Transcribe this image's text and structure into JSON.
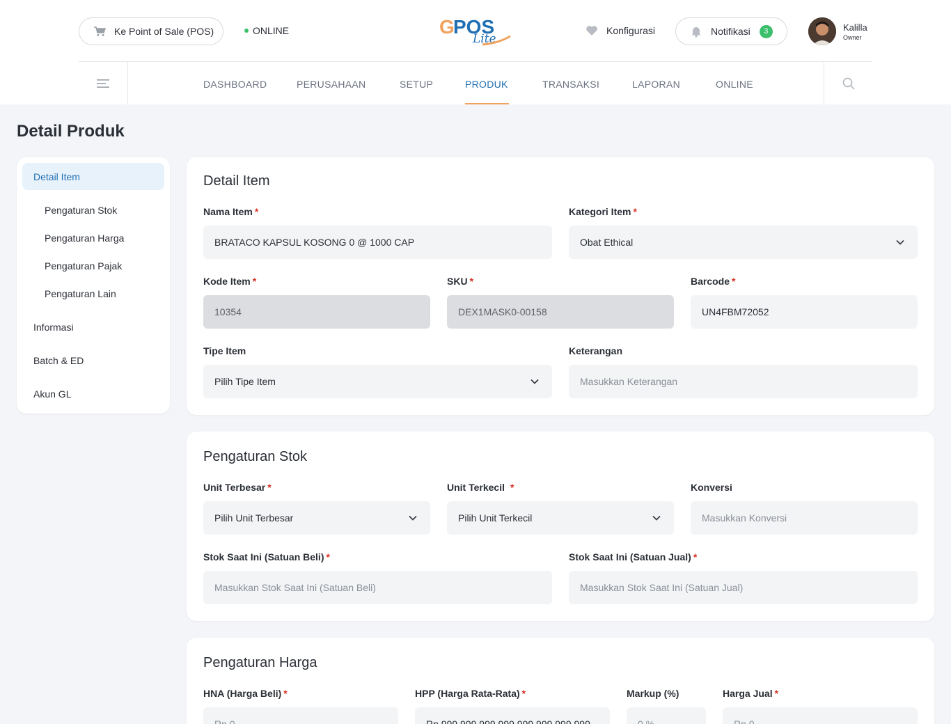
{
  "header": {
    "pos_button": "Ke Point of Sale (POS)",
    "status": "ONLINE",
    "konfigurasi": "Konfigurasi",
    "notifikasi": "Notifikasi",
    "notif_count": "3",
    "user_name": "Kalilla",
    "user_role": "Owner",
    "logo_text": "GPOS",
    "logo_sub": "Lite"
  },
  "nav": {
    "items": [
      "DASHBOARD",
      "PERUSAHAAN",
      "SETUP",
      "PRODUK",
      "TRANSAKSI",
      "LAPORAN",
      "ONLINE"
    ],
    "active": "PRODUK"
  },
  "page": {
    "title": "Detail Produk"
  },
  "sidemenu": {
    "items": [
      "Detail Item",
      "Pengaturan Stok",
      "Pengaturan Harga",
      "Pengaturan Pajak",
      "Pengaturan Lain",
      "Informasi",
      "Batch & ED",
      "Akun GL"
    ]
  },
  "detail_item": {
    "title": "Detail Item",
    "nama_label": "Nama Item",
    "nama_value": "BRATACO KAPSUL KOSONG 0 @ 1000 CAP",
    "kategori_label": "Kategori Item",
    "kategori_value": "Obat Ethical",
    "kode_label": "Kode Item",
    "kode_value": "10354",
    "sku_label": "SKU",
    "sku_value": "DEX1MASK0-00158",
    "barcode_label": "Barcode",
    "barcode_value": "UN4FBM72052",
    "tipe_label": "Tipe Item",
    "tipe_placeholder": "Pilih Tipe Item",
    "ket_label": "Keterangan",
    "ket_placeholder": "Masukkan Keterangan"
  },
  "stok": {
    "title": "Pengaturan Stok",
    "unit_besar_label": "Unit Terbesar",
    "unit_besar_placeholder": "Pilih Unit Terbesar",
    "unit_kecil_label": "Unit Terkecil",
    "unit_kecil_placeholder": "Pilih Unit Terkecil",
    "konversi_label": "Konversi",
    "konversi_placeholder": "Masukkan Konversi",
    "stok_beli_label": "Stok Saat Ini (Satuan Beli)",
    "stok_beli_placeholder": "Masukkan Stok Saat Ini (Satuan Beli)",
    "stok_jual_label": "Stok Saat Ini (Satuan Jual)",
    "stok_jual_placeholder": "Masukkan Stok Saat Ini (Satuan Jual)"
  },
  "harga": {
    "title": "Pengaturan Harga",
    "hna_label": "HNA (Harga Beli)",
    "hna_placeholder": "Rp 0",
    "hpp_label": "HPP (Harga Rata-Rata)",
    "hpp_value": "Rp 999.999.999.999.999.999.999.999",
    "markup_label": "Markup (%)",
    "markup_placeholder": "0 %",
    "jual_label": "Harga Jual",
    "jual_placeholder": "Rp 0"
  },
  "colors": {
    "accent": "#1f6fb2",
    "active_underline": "#f0a35e",
    "online_dot": "#3bbf6b",
    "required": "#d93025"
  }
}
